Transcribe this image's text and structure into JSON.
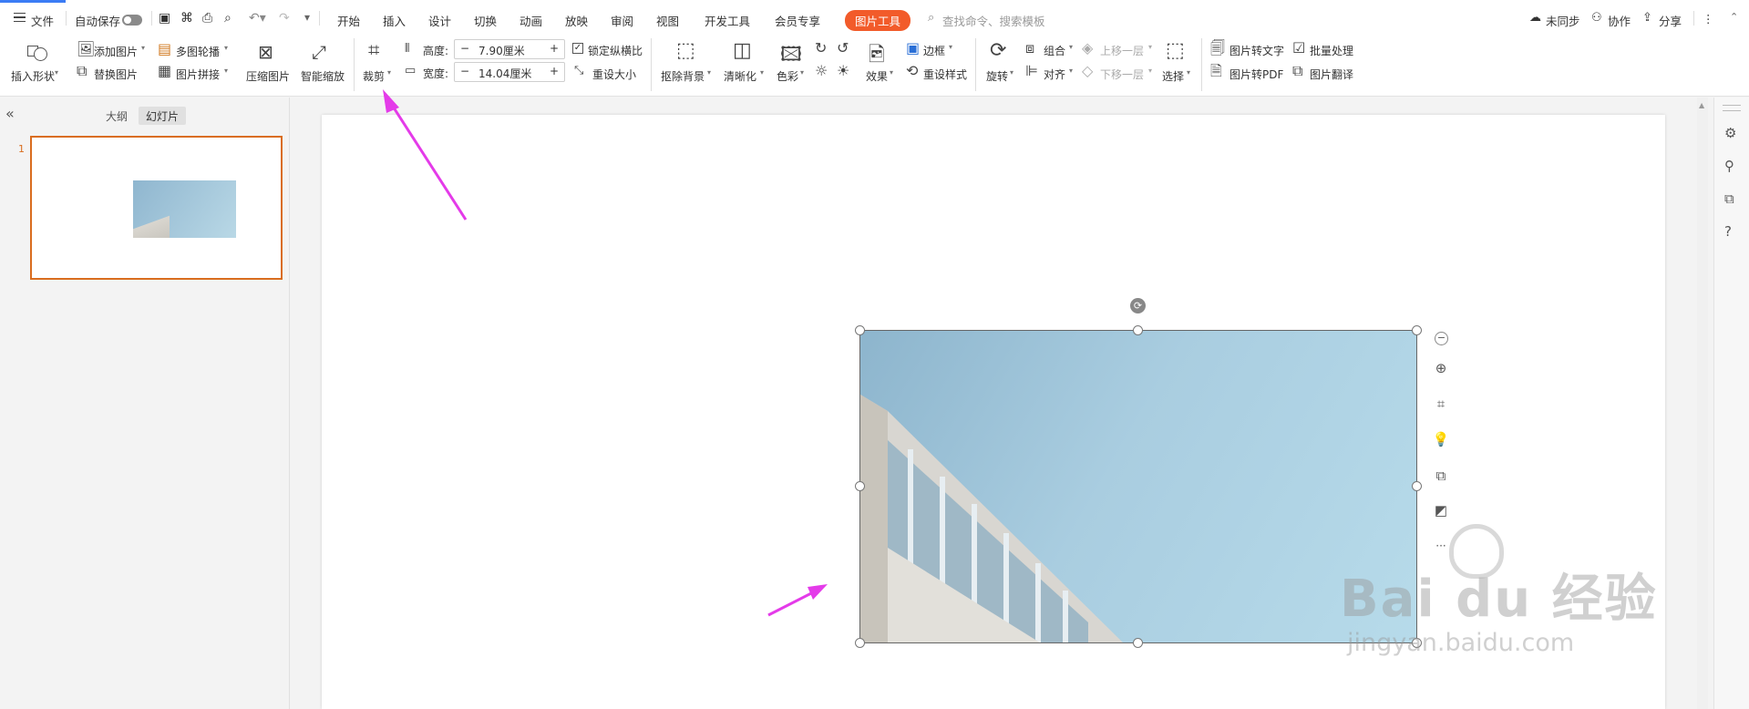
{
  "menubar": {
    "file": "文件",
    "autosave": "自动保存",
    "tabs": [
      "开始",
      "插入",
      "设计",
      "切换",
      "动画",
      "放映",
      "审阅",
      "视图",
      "开发工具",
      "会员专享"
    ],
    "active_tab": "图片工具",
    "search_placeholder": "查找命令、搜索模板",
    "not_synced": "未同步",
    "collaborate": "协作",
    "share": "分享",
    "more": "⋮",
    "accent_color": "#f25b2a"
  },
  "ribbon": {
    "insert_shape": "插入形状",
    "add_image": "添加图片",
    "replace_image": "替换图片",
    "multi_carousel": "多图轮播",
    "image_collage": "图片拼接",
    "compress": "压缩图片",
    "smart_zoom": "智能缩放",
    "crop": "裁剪",
    "height_label": "高度:",
    "height_value": "7.90厘米",
    "width_label": "宽度:",
    "width_value": "14.04厘米",
    "lock_ratio": "锁定纵横比",
    "reset_size": "重设大小",
    "remove_bg": "抠除背景",
    "sharpen": "清晰化",
    "color": "色彩",
    "effects": "效果",
    "border": "边框",
    "reset_style": "重设样式",
    "rotate": "旋转",
    "group": "组合",
    "align": "对齐",
    "bring_forward": "上移一层",
    "send_backward": "下移一层",
    "select": "选择",
    "img_to_text": "图片转文字",
    "batch": "批量处理",
    "img_to_pdf": "图片转PDF",
    "img_translate": "图片翻译"
  },
  "leftpane": {
    "collapse": "«",
    "tab_outline": "大纲",
    "tab_slides": "幻灯片",
    "slide_number": "1"
  },
  "float_toolbar": {
    "more": "···"
  },
  "watermark": {
    "brand": "Bai  du 经验",
    "url": "jingyan.baidu.com"
  }
}
